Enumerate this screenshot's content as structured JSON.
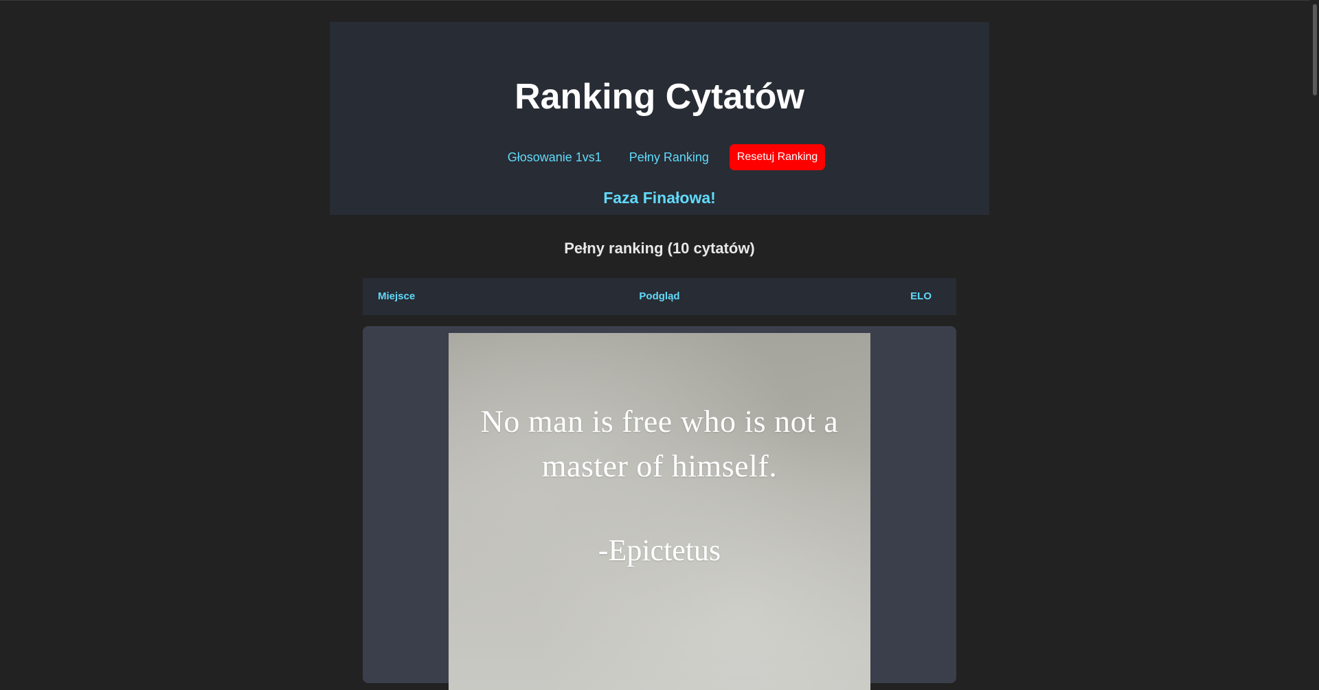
{
  "header": {
    "title": "Ranking Cytatów",
    "nav": {
      "vote_link": "Głosowanie 1vs1",
      "ranking_link": "Pełny Ranking",
      "reset_button": "Resetuj Ranking"
    },
    "phase": "Faza Finałowa!"
  },
  "ranking": {
    "title": "Pełny ranking (10 cytatów)",
    "columns": {
      "rank": "Miejsce",
      "preview": "Podgląd",
      "elo": "ELO"
    },
    "rows": [
      {
        "quote_image": {
          "text": "No man is free who is not a master of himself.",
          "author": "-Epictetus"
        }
      }
    ]
  },
  "colors": {
    "page_background": "#222222",
    "header_background": "#282c34",
    "accent": "#61dafb",
    "reset_button": "#ff0000",
    "row_background": "#3b3f4b"
  }
}
